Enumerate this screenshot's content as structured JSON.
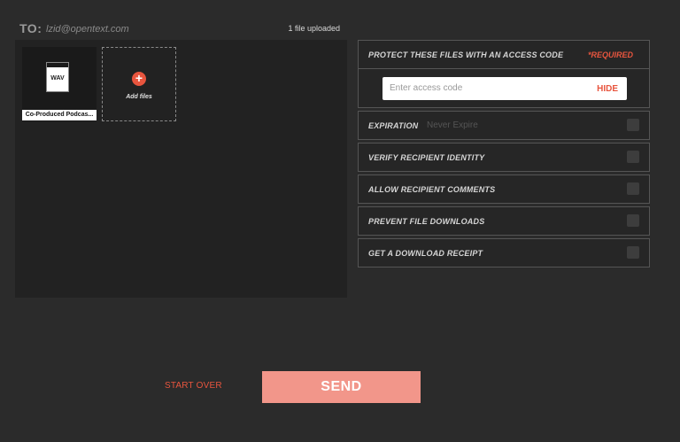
{
  "recipient": {
    "to_label": "TO:",
    "email": "lzid@opentext.com",
    "upload_count": "1 file uploaded"
  },
  "files": {
    "items": [
      {
        "type": "WAV",
        "name": "Co-Produced Podcas..."
      }
    ],
    "add_label": "Add files",
    "add_symbol": "+"
  },
  "options": {
    "access_code": {
      "label": "PROTECT THESE FILES WITH AN ACCESS CODE",
      "required": "*REQUIRED",
      "placeholder": "Enter access code",
      "hide_label": "HIDE"
    },
    "expiration": {
      "label": "EXPIRATION",
      "value": "Never Expire"
    },
    "verify": {
      "label": "VERIFY RECIPIENT IDENTITY"
    },
    "comments": {
      "label": "ALLOW RECIPIENT COMMENTS"
    },
    "prevent_downloads": {
      "label": "PREVENT FILE DOWNLOADS"
    },
    "receipt": {
      "label": "GET A DOWNLOAD RECEIPT"
    }
  },
  "actions": {
    "start_over": "START OVER",
    "send": "SEND"
  },
  "colors": {
    "accent": "#e8553e",
    "send_button": "#f2968a",
    "background": "#2b2b2b"
  },
  "icons": {
    "file": "wav-file-icon",
    "add": "plus-circle-icon"
  }
}
